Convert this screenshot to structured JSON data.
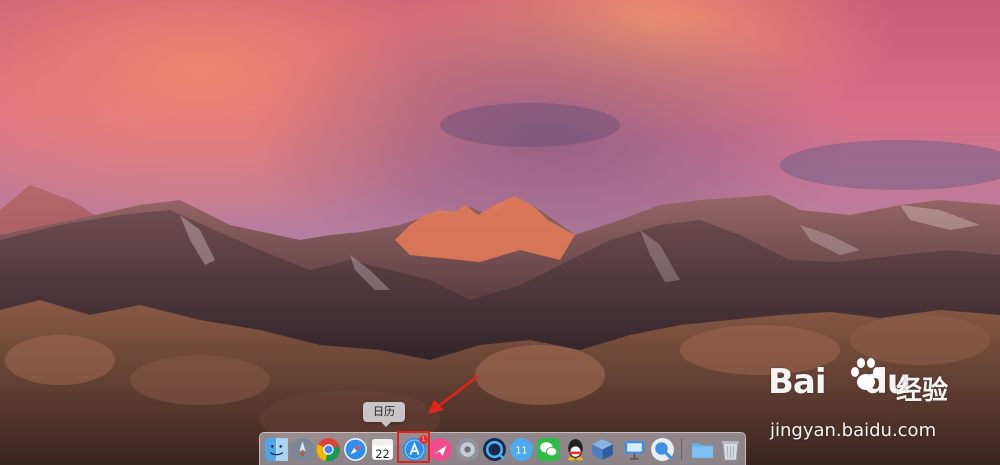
{
  "dock": {
    "tooltip": "日历",
    "calendar_day": "22",
    "appstore_badge": "1",
    "items": [
      {
        "name": "finder"
      },
      {
        "name": "launchpad"
      },
      {
        "name": "chrome"
      },
      {
        "name": "safari"
      },
      {
        "name": "calendar"
      },
      {
        "name": "app-store"
      },
      {
        "name": "paw-app"
      },
      {
        "name": "system-preferences"
      },
      {
        "name": "browser-globe"
      },
      {
        "name": "qq-browser"
      },
      {
        "name": "wechat"
      },
      {
        "name": "qq"
      },
      {
        "name": "virtualbox"
      },
      {
        "name": "keynote"
      },
      {
        "name": "screen-capture"
      },
      {
        "name": "downloads-folder"
      },
      {
        "name": "trash"
      }
    ]
  },
  "watermark": {
    "logo_text": "Bai",
    "logo_suffix": "du",
    "cn_text": "经验",
    "url": "jingyan.baidu.com"
  },
  "colors": {
    "highlight": "#e0241c",
    "arrow": "#e0241c"
  }
}
